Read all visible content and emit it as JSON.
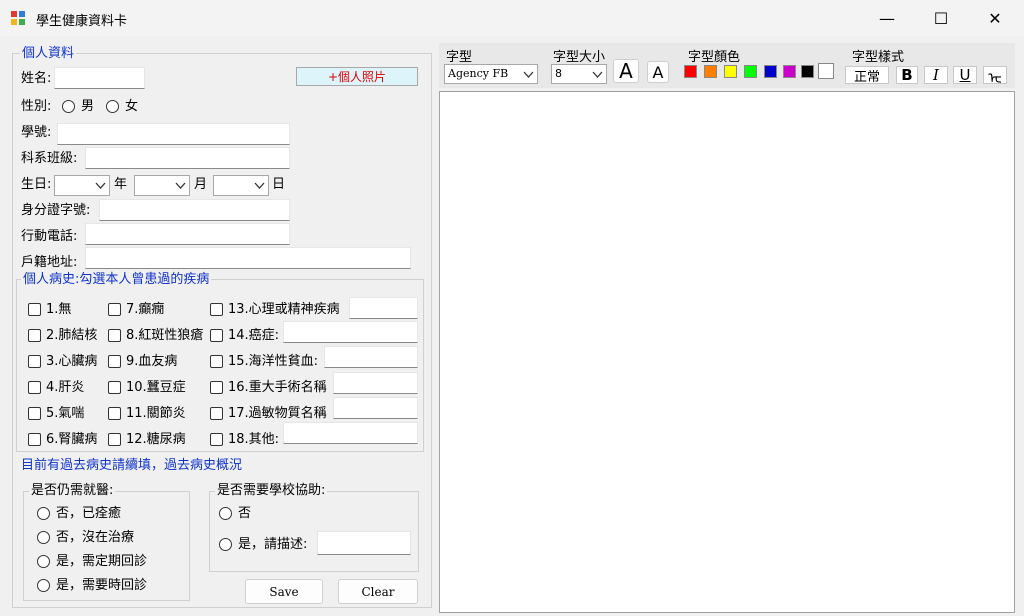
{
  "window": {
    "title": "學生健康資料卡",
    "minimize_icon": "—",
    "maximize_icon": "☐",
    "close_icon": "✕"
  },
  "personal": {
    "legend": "個人資料",
    "name_label": "姓名:",
    "photo_button": "+個人照片",
    "gender_label": "性別:",
    "gender_male": "男",
    "gender_female": "女",
    "student_id_label": "學號:",
    "dept_class_label": "科系班級:",
    "birthday_label": "生日:",
    "year_unit": "年",
    "month_unit": "月",
    "day_unit": "日",
    "id_number_label": "身分證字號:",
    "mobile_label": "行動電話:",
    "address_label": "戶籍地址:"
  },
  "history": {
    "legend": "個人病史:勾選本人曾患過的疾病",
    "col1": [
      "1.無",
      "2.肺結核",
      "3.心臟病",
      "4.肝炎",
      "5.氣喘",
      "6.腎臟病"
    ],
    "col2": [
      "7.癲癇",
      "8.紅斑性狼瘡",
      "9.血友病",
      "10.蠶豆症",
      "11.關節炎",
      "12.糖尿病"
    ],
    "col3": [
      "13.心理或精神疾病",
      "14.癌症:",
      "15.海洋性貧血:",
      "16.重大手術名稱",
      "17.過敏物質名稱",
      "18.其他:"
    ]
  },
  "followup_note": "目前有過去病史請續填，過去病史概況",
  "medical": {
    "legend": "是否仍需就醫:",
    "options": [
      "否，已痊癒",
      "否，沒在治療",
      "是，需定期回診",
      "是，需要時回診"
    ]
  },
  "school_help": {
    "legend": "是否需要學校協助:",
    "options": [
      "否",
      "是，請描述:"
    ]
  },
  "buttons": {
    "save": "Save",
    "clear": "Clear"
  },
  "toolbar": {
    "font_label": "字型",
    "font_value": "Agency FB",
    "size_label": "字型大小",
    "size_value": "8",
    "grow_icon": "A",
    "shrink_icon": "A",
    "color_label": "字型顏色",
    "colors": [
      "#ff0000",
      "#ff8000",
      "#ffff00",
      "#00ff00",
      "#0000cc",
      "#cc00cc",
      "#000000",
      "#ffffff"
    ],
    "style_label": "字型樣式",
    "style_normal": "正常",
    "style_bold": "B",
    "style_italic": "I",
    "style_underline": "U",
    "style_strike": "ᡄ"
  }
}
